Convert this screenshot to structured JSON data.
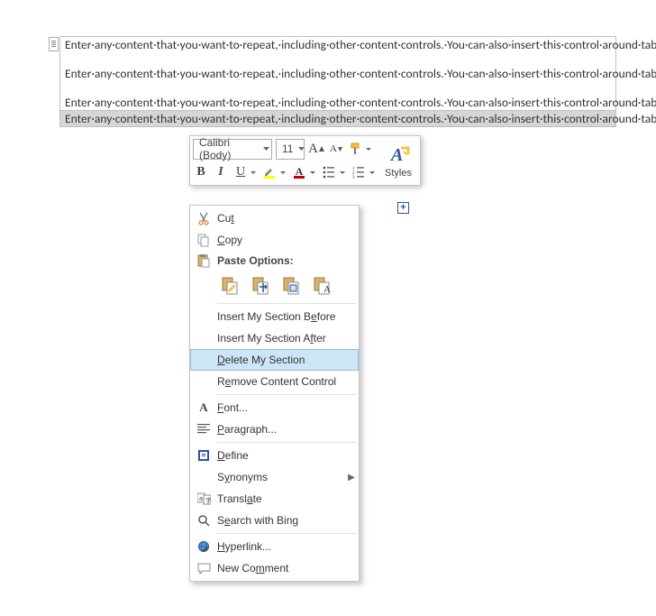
{
  "document": {
    "cell1_paragraphs": [
      "Enter·any·content·that·you·want·to·repeat,·including·other·content·controls.·You·can·also·insert·this·control·around·table·rows·in·order·to·repeat·parts·of·a·table.¶",
      "Enter·any·content·that·you·want·to·repeat,·including·other·content·controls.·You·can·also·insert·this·control·around·table·rows·in·order·to·repeat·parts·of·a·table.¶",
      "Enter·any·content·that·you·want·to·repeat,·including·other·content·controls.·You·can·also·insert·this·control·around·table·rows·in·order·to·repeat·parts·of·a·table.¶"
    ],
    "cell2_paragraph": "Enter·any·content·that·you·want·to·repeat,·including·other·content·controls.·You·can·also·insert·this·control·around·table·rows·in·order·to·repeat·parts·of·a·table.¶"
  },
  "add_button": "+",
  "mini_toolbar": {
    "font_name": "Calibri (Body)",
    "font_size": "11",
    "grow_font": "A",
    "shrink_font": "A",
    "bold": "B",
    "italic": "I",
    "underline": "U",
    "styles_label": "Styles"
  },
  "context_menu": {
    "cut": "Cut",
    "copy": "Copy",
    "paste_options": "Paste Options:",
    "insert_before_pre": "Insert My Section B",
    "insert_before_mn": "e",
    "insert_before_post": "fore",
    "insert_after_pre": "Insert My Section A",
    "insert_after_mn": "f",
    "insert_after_post": "ter",
    "delete_section_mn": "D",
    "delete_section_post": "elete My Section",
    "remove_cc_pre": "R",
    "remove_cc_mn": "e",
    "remove_cc_post": "move Content Control",
    "font_mn": "F",
    "font_post": "ont...",
    "paragraph_mn": "P",
    "paragraph_post": "aragraph...",
    "define_mn": "D",
    "define_post": "efine",
    "synonyms_pre": "S",
    "synonyms_mn": "y",
    "synonyms_post": "nonyms",
    "translate_pre": "Transl",
    "translate_mn": "a",
    "translate_post": "te",
    "searchbing_pre": "S",
    "searchbing_mn": "e",
    "searchbing_post": "arch with Bing",
    "hyperlink_mn": "H",
    "hyperlink_post": "yperlink...",
    "newcomment_pre": "New Co",
    "newcomment_mn": "m",
    "newcomment_post": "ment"
  }
}
